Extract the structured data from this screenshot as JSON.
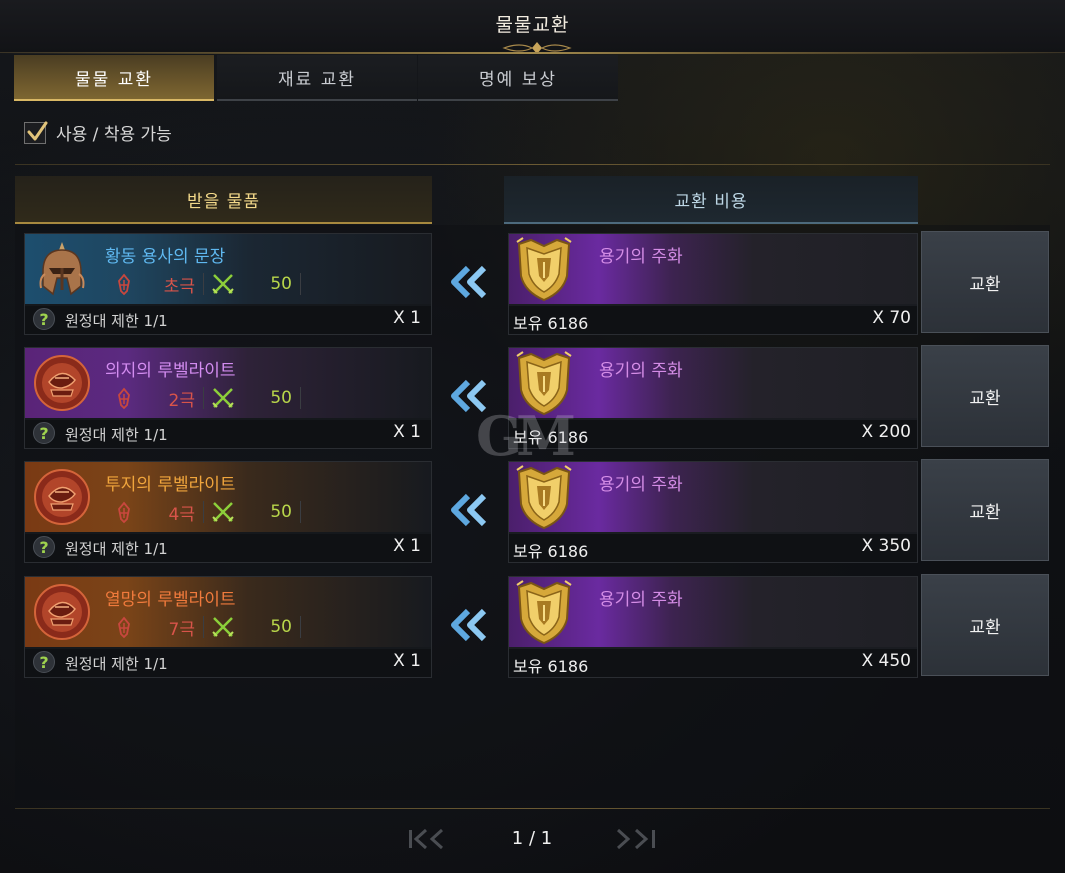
{
  "window": {
    "title": "물물교환"
  },
  "tabs": [
    {
      "label": "물물 교환",
      "active": true
    },
    {
      "label": "재료 교환",
      "active": false
    },
    {
      "label": "명예 보상",
      "active": false
    }
  ],
  "filter": {
    "label": "사용 / 착용 가능",
    "checked": true
  },
  "columns": {
    "receive": "받을 물품",
    "cost": "교환 비용"
  },
  "rows": [
    {
      "reward": {
        "name": "황동 용사의 문장",
        "name_color": "#5fb8f0",
        "grade": "초극",
        "level": "50",
        "limit": "원정대 제한 1/1",
        "qty": "X 1",
        "icon": "helmet-icon",
        "bg": "blue"
      },
      "cost": {
        "name": "용기의 주화",
        "owned": "보유 6186",
        "qty": "X 70",
        "icon": "courage-coin-icon"
      },
      "button": "교환"
    },
    {
      "reward": {
        "name": "의지의 루벨라이트",
        "name_color": "#d38cf0",
        "grade": "2극",
        "level": "50",
        "limit": "원정대 제한 1/1",
        "qty": "X 1",
        "icon": "rubellite-icon",
        "bg": "purple"
      },
      "cost": {
        "name": "용기의 주화",
        "owned": "보유 6186",
        "qty": "X 200",
        "icon": "courage-coin-icon"
      },
      "button": "교환"
    },
    {
      "reward": {
        "name": "투지의 루벨라이트",
        "name_color": "#f0a53c",
        "grade": "4극",
        "level": "50",
        "limit": "원정대 제한 1/1",
        "qty": "X 1",
        "icon": "rubellite-icon",
        "bg": "orange"
      },
      "cost": {
        "name": "용기의 주화",
        "owned": "보유 6186",
        "qty": "X 350",
        "icon": "courage-coin-icon"
      },
      "button": "교환"
    },
    {
      "reward": {
        "name": "열망의 루벨라이트",
        "name_color": "#f07a3c",
        "grade": "7극",
        "level": "50",
        "limit": "원정대 제한 1/1",
        "qty": "X 1",
        "icon": "rubellite-icon",
        "bg": "orange"
      },
      "cost": {
        "name": "용기의 주화",
        "owned": "보유 6186",
        "qty": "X 450",
        "icon": "courage-coin-icon"
      },
      "button": "교환"
    }
  ],
  "pagination": {
    "text": "1 / 1"
  },
  "watermark": "GM"
}
